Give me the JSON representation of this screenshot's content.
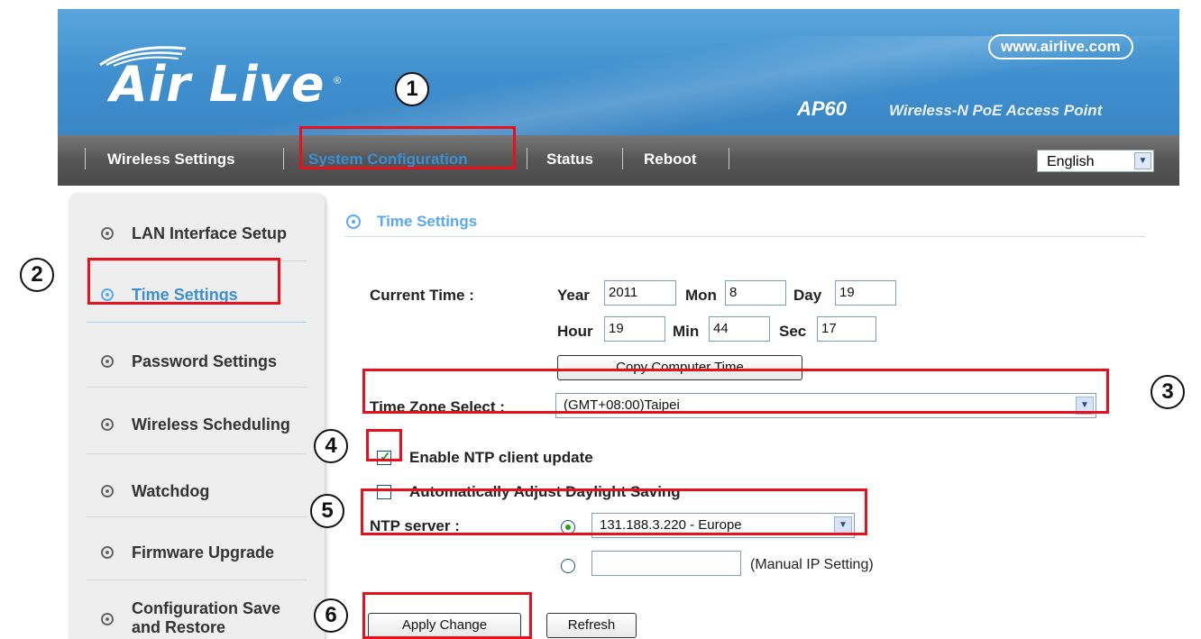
{
  "header": {
    "logo_text": "Air Live",
    "url": "www.airlive.com",
    "model": "AP60",
    "model_desc": "Wireless-N PoE Access Point"
  },
  "nav": {
    "items": [
      "Wireless Settings",
      "System Configuration",
      "Status",
      "Reboot"
    ],
    "language": "English"
  },
  "sidebar": {
    "items": [
      {
        "label": "LAN Interface Setup"
      },
      {
        "label": "Time Settings",
        "active": true
      },
      {
        "label": "Password Settings"
      },
      {
        "label": "Wireless Scheduling"
      },
      {
        "label": "Watchdog"
      },
      {
        "label": "Firmware Upgrade"
      },
      {
        "label": "Configuration Save and Restore",
        "line1": "Configuration Save",
        "line2": "and Restore"
      }
    ]
  },
  "content": {
    "section_title": "Time Settings",
    "current_time_label": "Current Time :",
    "time": {
      "year_label": "Year",
      "year": "2011",
      "mon_label": "Mon",
      "mon": "8",
      "day_label": "Day",
      "day": "19",
      "hour_label": "Hour",
      "hour": "19",
      "min_label": "Min",
      "min": "44",
      "sec_label": "Sec",
      "sec": "17"
    },
    "copy_button": "Copy Computer Time",
    "timezone_label": "Time Zone Select :",
    "timezone_value": "(GMT+08:00)Taipei",
    "ntp_enable_label": "Enable NTP client update",
    "ntp_enable_checked": true,
    "daylight_label": "Automatically Adjust Daylight Saving",
    "daylight_checked": false,
    "ntp_server_label": "NTP server :",
    "ntp_server_value": "131.188.3.220 - Europe",
    "manual_ip_value": "",
    "manual_ip_label": "(Manual IP Setting)",
    "apply_button": "Apply Change",
    "refresh_button": "Refresh"
  },
  "annotations": [
    "1",
    "2",
    "3",
    "4",
    "5",
    "6"
  ],
  "colors": {
    "highlight": "#e8101a",
    "accent": "#58aaf0",
    "nav_bg": "#555555",
    "banner_bg": "#4a96d4"
  }
}
